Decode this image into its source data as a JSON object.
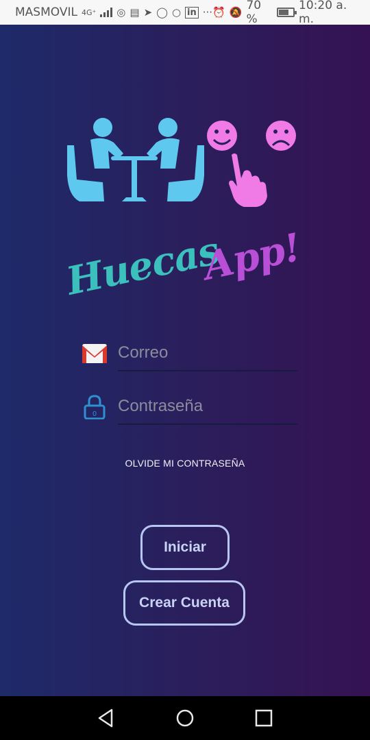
{
  "status_bar": {
    "carrier": "MASMOVIL",
    "network": "4G⁺",
    "battery_percent": "70 %",
    "battery_level": 0.7,
    "time": "10:20 a. m.",
    "icons": [
      "signal-icon",
      "hotspot-icon",
      "news-icon",
      "nfc-icon",
      "whatsapp-icon",
      "sync-icon",
      "linkedin-icon",
      "more-icon",
      "alarm-icon",
      "mute-icon",
      "battery-icon"
    ]
  },
  "brand": {
    "name_part1": "Huecas",
    "name_part2": "App!",
    "colors": {
      "teal": "#3cc0bd",
      "purple": "#b84fd6",
      "figures": "#5fc8ef",
      "pink": "#f07be6"
    }
  },
  "login_form": {
    "email_placeholder": "Correo",
    "email_value": "",
    "password_placeholder": "Contraseña",
    "password_value": "",
    "forgot_password": "OLVIDE MI CONTRASEÑA",
    "login_button": "Iniciar",
    "create_account_button": "Crear Cuenta"
  },
  "nav_bar": {
    "items": [
      "back-icon",
      "home-icon",
      "recents-icon"
    ]
  }
}
